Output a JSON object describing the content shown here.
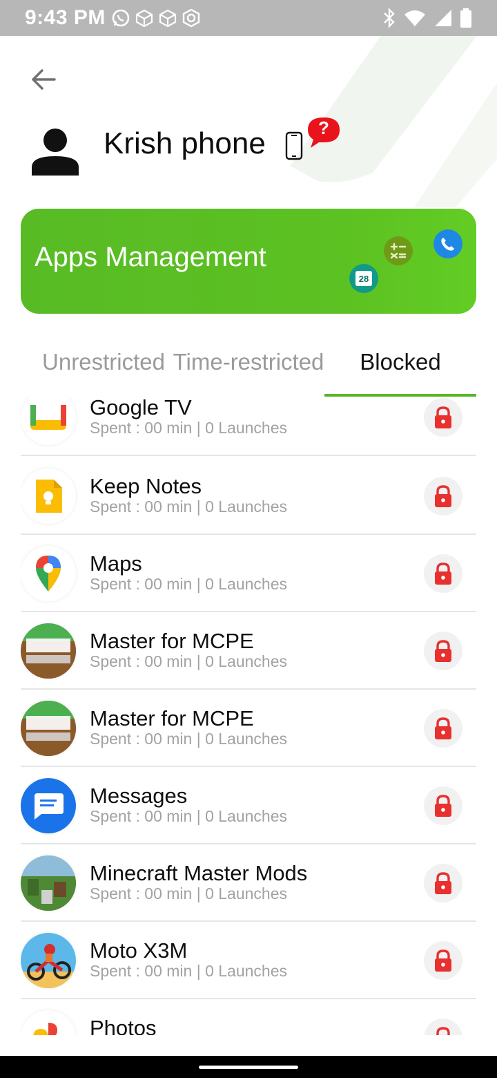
{
  "status_bar": {
    "time": "9:43 PM",
    "notification_icons": [
      "whatsapp-icon",
      "cube-icon",
      "cube-icon",
      "hexagon-settings-icon"
    ],
    "system_icons": [
      "bluetooth-icon",
      "wifi-icon",
      "signal-icon",
      "battery-icon"
    ]
  },
  "header": {
    "back_icon": "arrow-left-icon",
    "device_name": "Krish phone",
    "help_mark": "?"
  },
  "banner": {
    "title": "Apps Management",
    "calendar_day": "28",
    "color": "#5cc122"
  },
  "tabs": [
    {
      "label": "Unrestricted",
      "active": false
    },
    {
      "label": "Time-restricted",
      "active": false
    },
    {
      "label": "Blocked",
      "active": true
    }
  ],
  "apps": [
    {
      "name": "Google TV",
      "stats": "Spent : 00 min | 0 Launches",
      "icon": "google-tv-icon"
    },
    {
      "name": "Keep Notes",
      "stats": "Spent : 00 min | 0 Launches",
      "icon": "keep-notes-icon"
    },
    {
      "name": "Maps",
      "stats": "Spent : 00 min | 0 Launches",
      "icon": "maps-icon"
    },
    {
      "name": "Master for MCPE",
      "stats": "Spent : 00 min | 0 Launches",
      "icon": "mod-master-icon"
    },
    {
      "name": "Master for MCPE",
      "stats": "Spent : 00 min | 0 Launches",
      "icon": "mod-master-icon"
    },
    {
      "name": "Messages",
      "stats": "Spent : 00 min | 0 Launches",
      "icon": "messages-icon"
    },
    {
      "name": "Minecraft Master Mods",
      "stats": "Spent : 00 min | 0 Launches",
      "icon": "minecraft-icon"
    },
    {
      "name": "Moto X3M",
      "stats": "Spent : 00 min | 0 Launches",
      "icon": "moto-x3m-icon"
    },
    {
      "name": "Photos",
      "stats": "",
      "icon": "photos-icon"
    }
  ],
  "colors": {
    "accent": "#5ab52a",
    "lock": "#e8302f",
    "inactive_tab": "#9a9a9a",
    "secondary_text": "#a2a2a2"
  }
}
